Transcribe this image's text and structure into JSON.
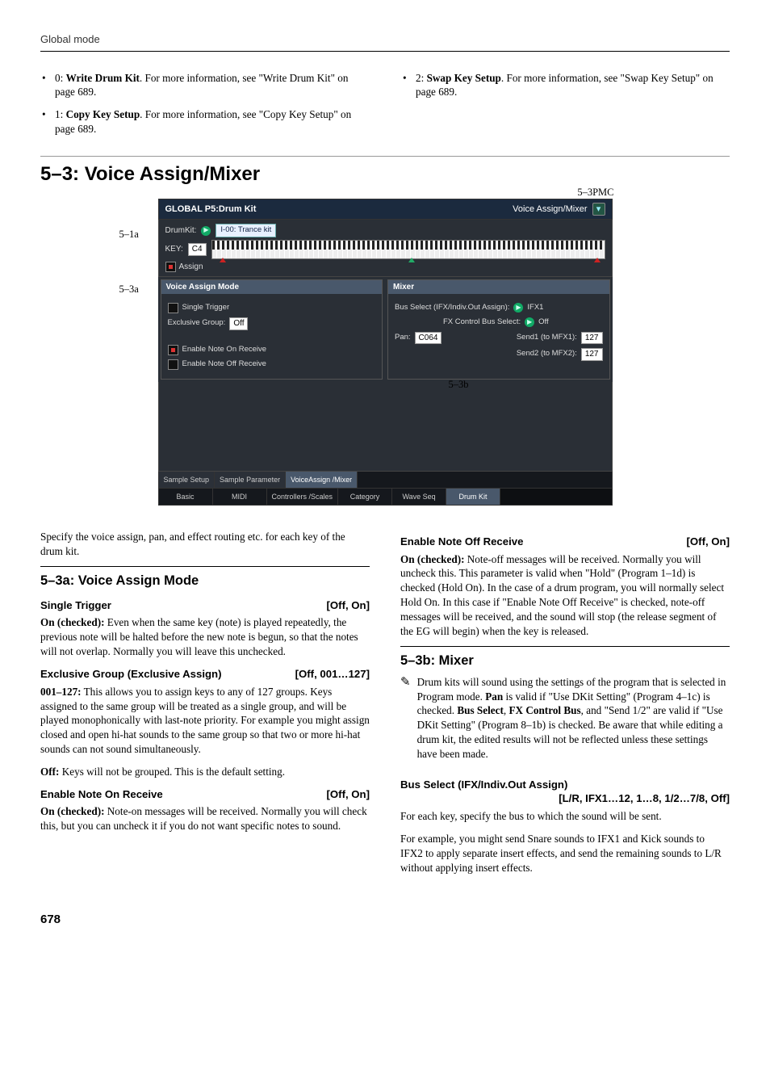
{
  "header": {
    "title": "Global mode"
  },
  "intro_bullets": {
    "left": [
      "0: <b>Write Drum Kit</b>. For more information, see \"Write Drum Kit\" on page 689.",
      "1: <b>Copy Key Setup</b>. For more information, see \"Copy Key Setup\" on page 689."
    ],
    "right": [
      "2: <b>Swap Key Setup</b>. For more information, see \"Swap Key Setup\" on page 689."
    ]
  },
  "section_title": "5–3: Voice Assign/Mixer",
  "screenshot": {
    "labels": {
      "top_right": "5–3PMC",
      "left_a": "5–1a",
      "left_b": "5–3a",
      "bottom": "5–3b"
    },
    "titlebar": {
      "left": "GLOBAL P5:Drum Kit",
      "right": "Voice Assign/Mixer"
    },
    "drumkit": {
      "label": "DrumKit:",
      "value": "I-00: Trance kit"
    },
    "key": {
      "label": "KEY:",
      "value": "C4"
    },
    "assign": {
      "label": "Assign",
      "checked": true
    },
    "voice_mode": {
      "header": "Voice Assign Mode",
      "single_trigger": {
        "label": "Single Trigger",
        "checked": false
      },
      "exclusive": {
        "label": "Exclusive Group:",
        "value": "Off"
      },
      "note_on": {
        "label": "Enable Note On Receive",
        "checked": true
      },
      "note_off": {
        "label": "Enable Note Off Receive",
        "checked": false
      }
    },
    "mixer": {
      "header": "Mixer",
      "bus_select": {
        "label": "Bus Select (IFX/Indiv.Out Assign):",
        "value": "IFX1"
      },
      "fx_ctrl": {
        "label": "FX Control Bus Select:",
        "value": "Off"
      },
      "pan": {
        "label": "Pan:",
        "value": "C064"
      },
      "send1": {
        "label": "Send1 (to MFX1):",
        "value": "127"
      },
      "send2": {
        "label": "Send2 (to MFX2):",
        "value": "127"
      }
    },
    "tabs_sub": [
      "Sample Setup",
      "Sample Parameter",
      "VoiceAssign /Mixer"
    ],
    "tabs_main": [
      "Basic",
      "MIDI",
      "Controllers /Scales",
      "Category",
      "Wave Seq",
      "Drum Kit"
    ]
  },
  "left_col": {
    "intro": "Specify the voice assign, pan, and effect routing etc. for each key of the drum kit.",
    "h_5_3a": "5–3a: Voice Assign Mode",
    "single_trigger": {
      "name": "Single Trigger",
      "range": "[Off, On]"
    },
    "single_trigger_body": "<b>On (checked):</b> Even when the same key (note) is played repeatedly, the previous note will be halted before the new note is begun, so that the notes will not overlap. Normally you will leave this unchecked.",
    "exclusive": {
      "name": "Exclusive Group (Exclusive Assign)",
      "range": "[Off, 001…127]"
    },
    "exclusive_body1": "<b>001–127:</b> This allows you to assign keys to any of 127 groups. Keys assigned to the same group will be treated as a single group, and will be played monophonically with last-note priority. For example you might assign closed and open hi-hat sounds to the same group so that two or more hi-hat sounds can not sound simultaneously.",
    "exclusive_body2": "<b>Off:</b> Keys will not be grouped. This is the default setting.",
    "note_on": {
      "name": "Enable Note On Receive",
      "range": "[Off, On]"
    },
    "note_on_body": "<b>On (checked):</b> Note-on messages will be received. Normally you will check this, but you can uncheck it if you do not want specific notes to sound."
  },
  "right_col": {
    "note_off": {
      "name": "Enable Note Off Receive",
      "range": "[Off, On]"
    },
    "note_off_body": "<b>On (checked):</b> Note-off messages will be received. Normally you will uncheck this. This parameter is valid when \"Hold\" (Program 1–1d) is checked (Hold On). In the case of a drum program, you will normally select Hold On. In this case if \"Enable Note Off Receive\" is checked, note-off messages will be received, and the sound will stop (the release segment of the EG will begin) when the key is released.",
    "h_5_3b": "5–3b: Mixer",
    "mixer_note": "Drum kits will sound using the settings of the program that is selected in Program mode. <b>Pan</b> is valid if \"Use DKit Setting\" (Program 4–1c) is checked. <b>Bus Select</b>, <b>FX Control Bus</b>, and \"Send 1/2\" are valid if \"Use DKit Setting\" (Program 8–1b) is checked. Be aware that while editing a drum kit, the edited results will not be reflected unless these settings have been made.",
    "bus_select": {
      "name": "Bus Select (IFX/Indiv.Out Assign)",
      "range": "[L/R, IFX1…12, 1…8, 1/2…7/8, Off]"
    },
    "bus_body1": "For each key, specify the bus to which the sound will be sent.",
    "bus_body2": "For example, you might send Snare sounds to IFX1 and Kick sounds to IFX2 to apply separate insert effects, and send the remaining sounds to L/R without applying insert effects."
  },
  "page_number": "678"
}
